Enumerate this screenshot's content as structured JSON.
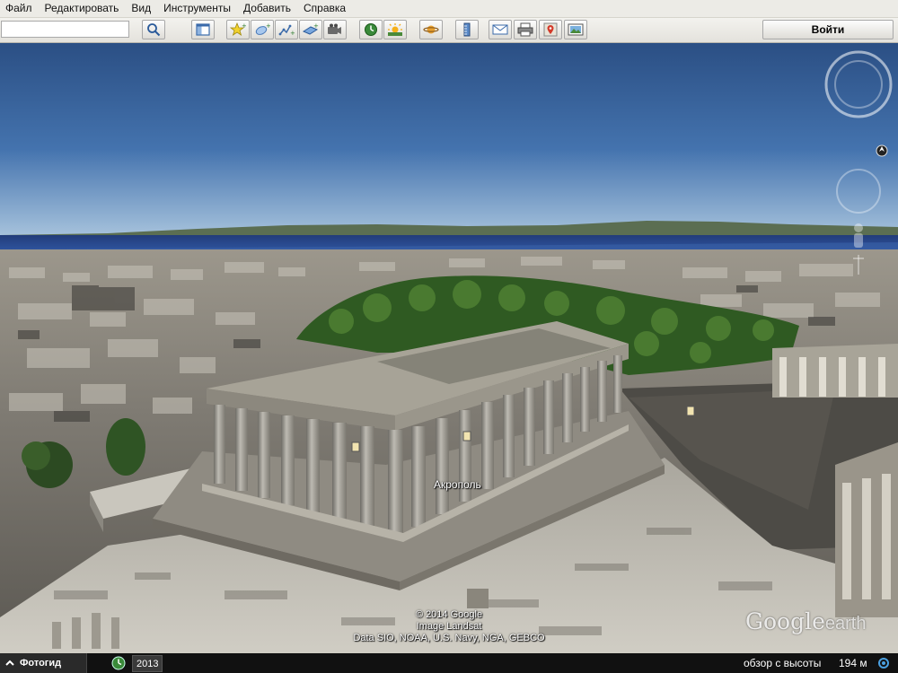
{
  "menu": [
    {
      "label": "Файл"
    },
    {
      "label": "Редактировать"
    },
    {
      "label": "Вид"
    },
    {
      "label": "Инструменты"
    },
    {
      "label": "Добавить"
    },
    {
      "label": "Справка"
    }
  ],
  "toolbar": {
    "search_value": "",
    "signin_label": "Войти"
  },
  "map": {
    "place_label": "Акрополь",
    "credit_1": "© 2014 Google",
    "credit_2": "Image Landsat",
    "credit_3": "Data SIO, NOAA, U.S. Navy, NGA, GEBCO",
    "logo_google": "Google",
    "logo_earth": "earth"
  },
  "statusbar": {
    "photo_guide_label": "Фотогид",
    "year": "2013",
    "eye_alt_label": "обзор с высоты",
    "eye_alt_value": "194 м"
  }
}
